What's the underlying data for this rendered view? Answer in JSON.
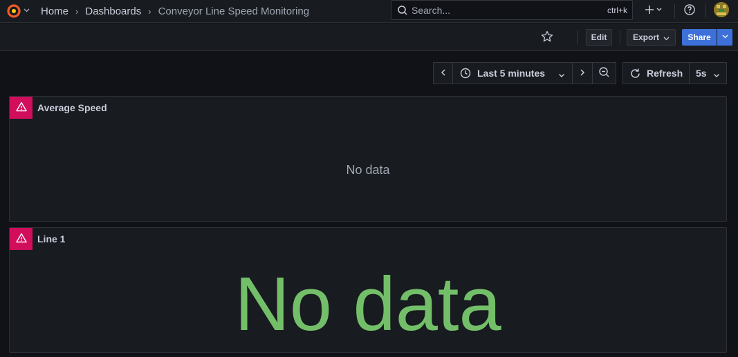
{
  "breadcrumb": {
    "home": "Home",
    "dashboards": "Dashboards",
    "current": "Conveyor Line Speed Monitoring"
  },
  "search": {
    "placeholder": "Search...",
    "shortcut": "ctrl+k"
  },
  "toolbar": {
    "edit_label": "Edit",
    "export_label": "Export",
    "share_label": "Share"
  },
  "time_controls": {
    "range_label": "Last 5 minutes",
    "refresh_label": "Refresh",
    "interval": "5s"
  },
  "panels": [
    {
      "title": "Average Speed",
      "no_data": "No data"
    },
    {
      "title": "Line 1",
      "no_data": "No data"
    }
  ],
  "colors": {
    "accent_blue": "#3d71d9",
    "error_pink": "#d10e5c",
    "nodata_green": "#73bf69",
    "logo_orange": "#f05a28"
  },
  "icons": [
    "grafana-logo-icon",
    "chevron-down-icon",
    "search-icon",
    "plus-icon",
    "help-icon",
    "avatar",
    "star-icon",
    "chevron-left-icon",
    "clock-icon",
    "chevron-right-icon",
    "zoom-out-icon",
    "refresh-icon",
    "warning-icon"
  ]
}
